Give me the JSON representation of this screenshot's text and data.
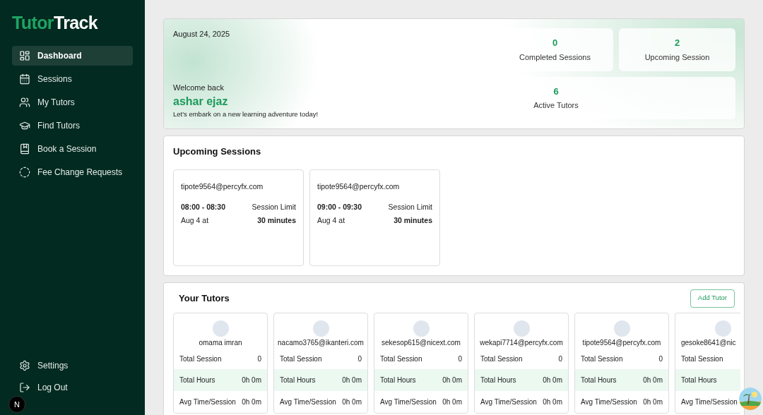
{
  "brand": {
    "part_1": "Tutor",
    "part_2": "Track"
  },
  "sidebar": {
    "items": [
      {
        "label": "Dashboard",
        "selected": true
      },
      {
        "label": "Sessions",
        "selected": false
      },
      {
        "label": "My Tutors",
        "selected": false
      },
      {
        "label": "Find Tutors",
        "selected": false
      },
      {
        "label": "Book a Session",
        "selected": false
      },
      {
        "label": "Fee Change Requests",
        "selected": false
      }
    ],
    "bottom_items": [
      {
        "label": "Settings"
      },
      {
        "label": "Log Out"
      }
    ]
  },
  "dev_badge": "N",
  "hero": {
    "date": "August 24, 2025",
    "welcome": "Welcome back",
    "name": "ashar ejaz",
    "tagline": "Let's embark on a new learning adventure today!",
    "stats": [
      {
        "value": "0",
        "label": "Completed Sessions"
      },
      {
        "value": "2",
        "label": "Upcoming Session"
      },
      {
        "value": "6",
        "label": "Active Tutors"
      }
    ]
  },
  "upcoming": {
    "title": "Upcoming Sessions",
    "sessions": [
      {
        "email": "tipote9564@percyfx.com",
        "time": "08:00 - 08:30",
        "date": "Aug 4 at",
        "limit_label": "Session Limit",
        "limit": "30 minutes"
      },
      {
        "email": "tipote9564@percyfx.com",
        "time": "09:00 - 09:30",
        "date": "Aug 4 at",
        "limit_label": "Session Limit",
        "limit": "30 minutes"
      }
    ]
  },
  "tutors": {
    "title": "Your Tutors",
    "add_button": "Add Tutor",
    "cards": [
      {
        "name": "omama imran",
        "stats": [
          {
            "label": "Total Session",
            "value": "0"
          },
          {
            "label": "Total Hours",
            "value": "0h 0m"
          },
          {
            "label": "Avg Time/Session",
            "value": "0h 0m"
          }
        ]
      },
      {
        "name": "nacamo3765@ikanteri.com",
        "stats": [
          {
            "label": "Total Session",
            "value": "0"
          },
          {
            "label": "Total Hours",
            "value": "0h 0m"
          },
          {
            "label": "Avg Time/Session",
            "value": "0h 0m"
          }
        ]
      },
      {
        "name": "sekesop615@nicext.com",
        "stats": [
          {
            "label": "Total Session",
            "value": "0"
          },
          {
            "label": "Total Hours",
            "value": "0h 0m"
          },
          {
            "label": "Avg Time/Session",
            "value": "0h 0m"
          }
        ]
      },
      {
        "name": "wekapi7714@percyfx.com",
        "stats": [
          {
            "label": "Total Session",
            "value": "0"
          },
          {
            "label": "Total Hours",
            "value": "0h 0m"
          },
          {
            "label": "Avg Time/Session",
            "value": "0h 0m"
          }
        ]
      },
      {
        "name": "tipote9564@percyfx.com",
        "stats": [
          {
            "label": "Total Session",
            "value": "0"
          },
          {
            "label": "Total Hours",
            "value": "0h 0m"
          },
          {
            "label": "Avg Time/Session",
            "value": "0h 0m"
          }
        ]
      },
      {
        "name": "gesoke8641@nic",
        "stats": [
          {
            "label": "Total Session"
          },
          {
            "label": "Total Hours"
          },
          {
            "label": "Avg Time/Session"
          }
        ]
      }
    ]
  }
}
